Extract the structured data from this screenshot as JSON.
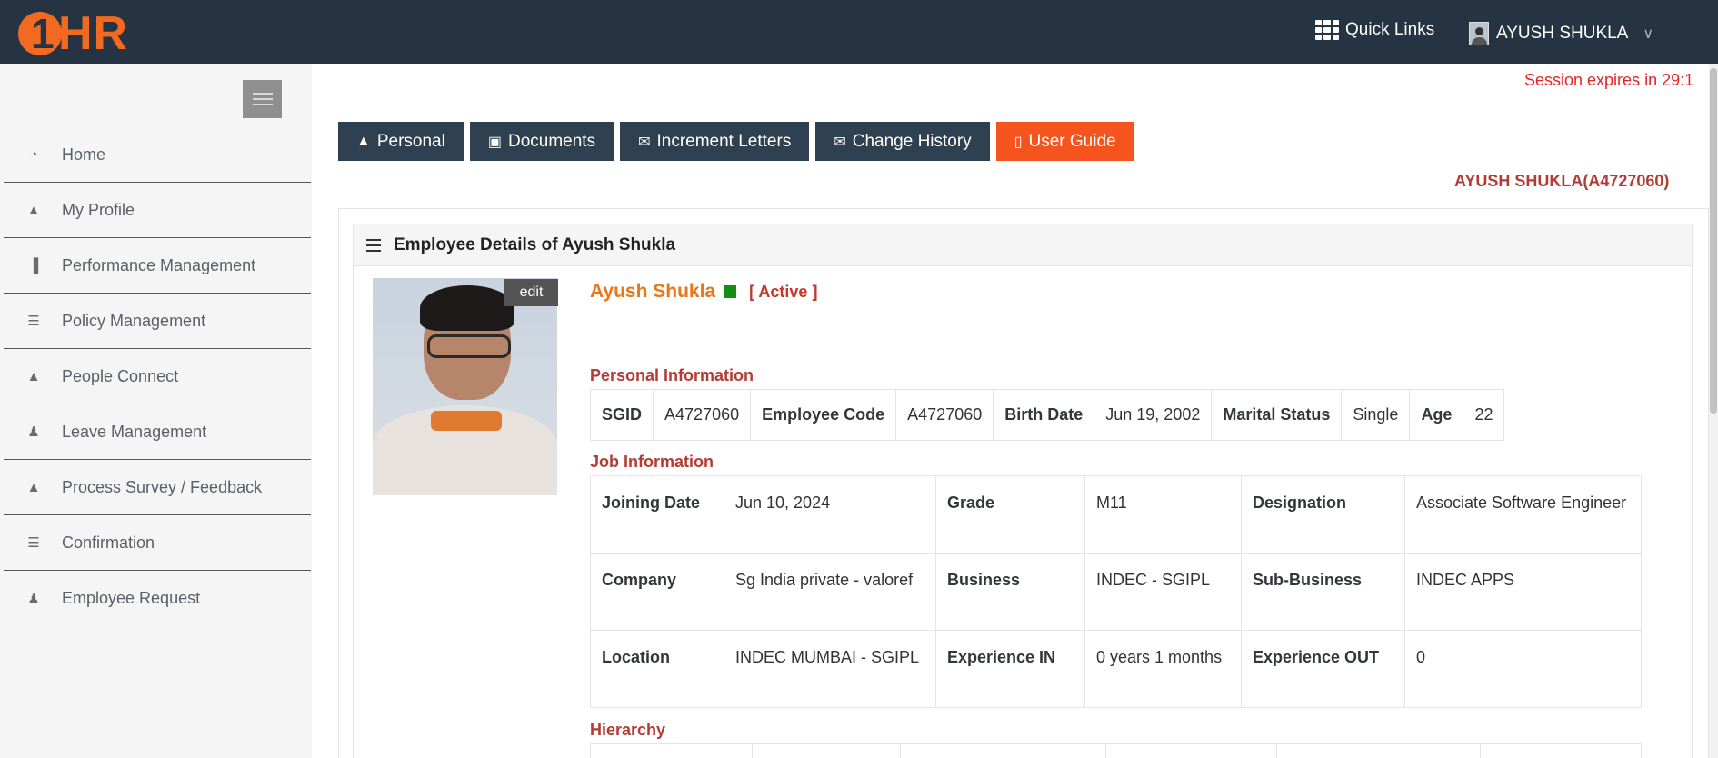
{
  "header": {
    "logo_text": "HR",
    "logo_number": "1",
    "quick_links": "Quick Links",
    "user_name": "AYUSH SHUKLA"
  },
  "sidebar": {
    "items": [
      {
        "label": "Home",
        "icon": "dashboard-icon"
      },
      {
        "label": "My Profile",
        "icon": "user-icon"
      },
      {
        "label": "Performance Management",
        "icon": "bar-chart-icon"
      },
      {
        "label": "Policy Management",
        "icon": "list-icon"
      },
      {
        "label": "People Connect",
        "icon": "user-icon"
      },
      {
        "label": "Leave Management",
        "icon": "user-secret-icon"
      },
      {
        "label": "Process Survey / Feedback",
        "icon": "user-icon"
      },
      {
        "label": "Confirmation",
        "icon": "list-icon"
      },
      {
        "label": "Employee Request",
        "icon": "user-secret-icon"
      }
    ]
  },
  "session": "Session expires in 29:1",
  "tabs": [
    "Personal",
    "Documents",
    "Increment Letters",
    "Change History",
    "User Guide"
  ],
  "employee_id_header": "AYUSH SHUKLA(A4727060)",
  "panel": {
    "title": "Employee Details of Ayush Shukla",
    "edit_label": "edit",
    "name": "Ayush Shukla",
    "status": "[ Active ]",
    "status_color": "#138f13"
  },
  "personal": {
    "title": "Personal Information",
    "sgid_label": "SGID",
    "sgid": "A4727060",
    "code_label": "Employee Code",
    "code": "A4727060",
    "birth_label": "Birth Date",
    "birth": "Jun 19, 2002",
    "marital_label": "Marital Status",
    "marital": "Single",
    "age_label": "Age",
    "age": "22"
  },
  "job": {
    "title": "Job Information",
    "joining_label": "Joining Date",
    "joining": "Jun 10, 2024",
    "grade_label": "Grade",
    "grade": "M11",
    "designation_label": "Designation",
    "designation": "Associate Software Engineer",
    "company_label": "Company",
    "company": "Sg India private - valoref",
    "business_label": "Business",
    "business": "INDEC - SGIPL",
    "subbusiness_label": "Sub-Business",
    "subbusiness": "INDEC APPS",
    "location_label": "Location",
    "location": "INDEC MUMBAI - SGIPL",
    "expin_label": "Experience IN",
    "expin": "0 years 1 months",
    "expout_label": "Experience OUT",
    "expout": "0"
  },
  "hierarchy": {
    "title": "Hierarchy"
  }
}
